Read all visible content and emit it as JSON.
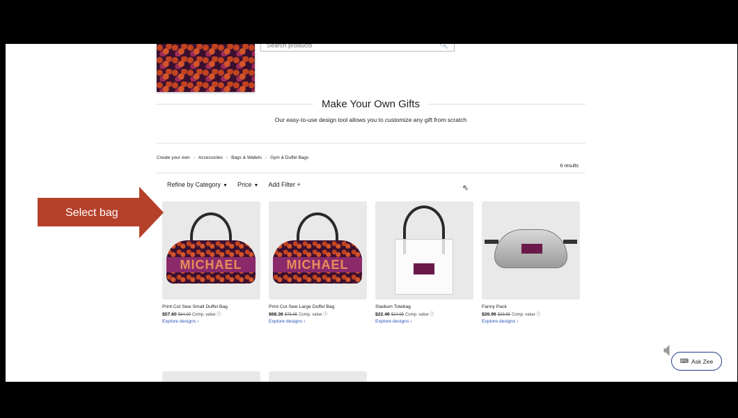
{
  "search": {
    "placeholder": "Search products"
  },
  "heading": "Make Your Own Gifts",
  "subtitle": "Our easy-to-use design tool allows you to customize any gift from scratch",
  "breadcrumb": [
    "Create your own",
    "Accessories",
    "Bags & Wallets",
    "Gym & Duffel Bags"
  ],
  "results": "6 results",
  "filters": {
    "category": "Refine by Category",
    "price": "Price",
    "add": "Add Filter +"
  },
  "products": [
    {
      "title": "Print Cut Sew Small Duffel Bag",
      "price": "$57.60",
      "was": "$64.00",
      "comp": "Comp. value ⓘ",
      "explore": "Explore designs ›",
      "print": "MICHAEL"
    },
    {
      "title": "Print Cut Sew Large Duffel Bag",
      "price": "$68.36",
      "was": "$75.95",
      "comp": "Comp. value ⓘ",
      "explore": "Explore designs ›",
      "print": "MICHAEL"
    },
    {
      "title": "Stadium Totebag",
      "price": "$22.46",
      "was": "$24.95",
      "comp": "Comp. value ⓘ",
      "explore": "Explore designs ›"
    },
    {
      "title": "Fanny Pack",
      "price": "$26.96",
      "was": "$29.95",
      "comp": "Comp. value ⓘ",
      "explore": "Explore designs ›"
    }
  ],
  "callout": "Select bag",
  "ask_zee": "Ask Zee",
  "colors": {
    "accent_arrow": "#b5412b",
    "link": "#2a52be",
    "ask_border": "#1e3a8a"
  }
}
